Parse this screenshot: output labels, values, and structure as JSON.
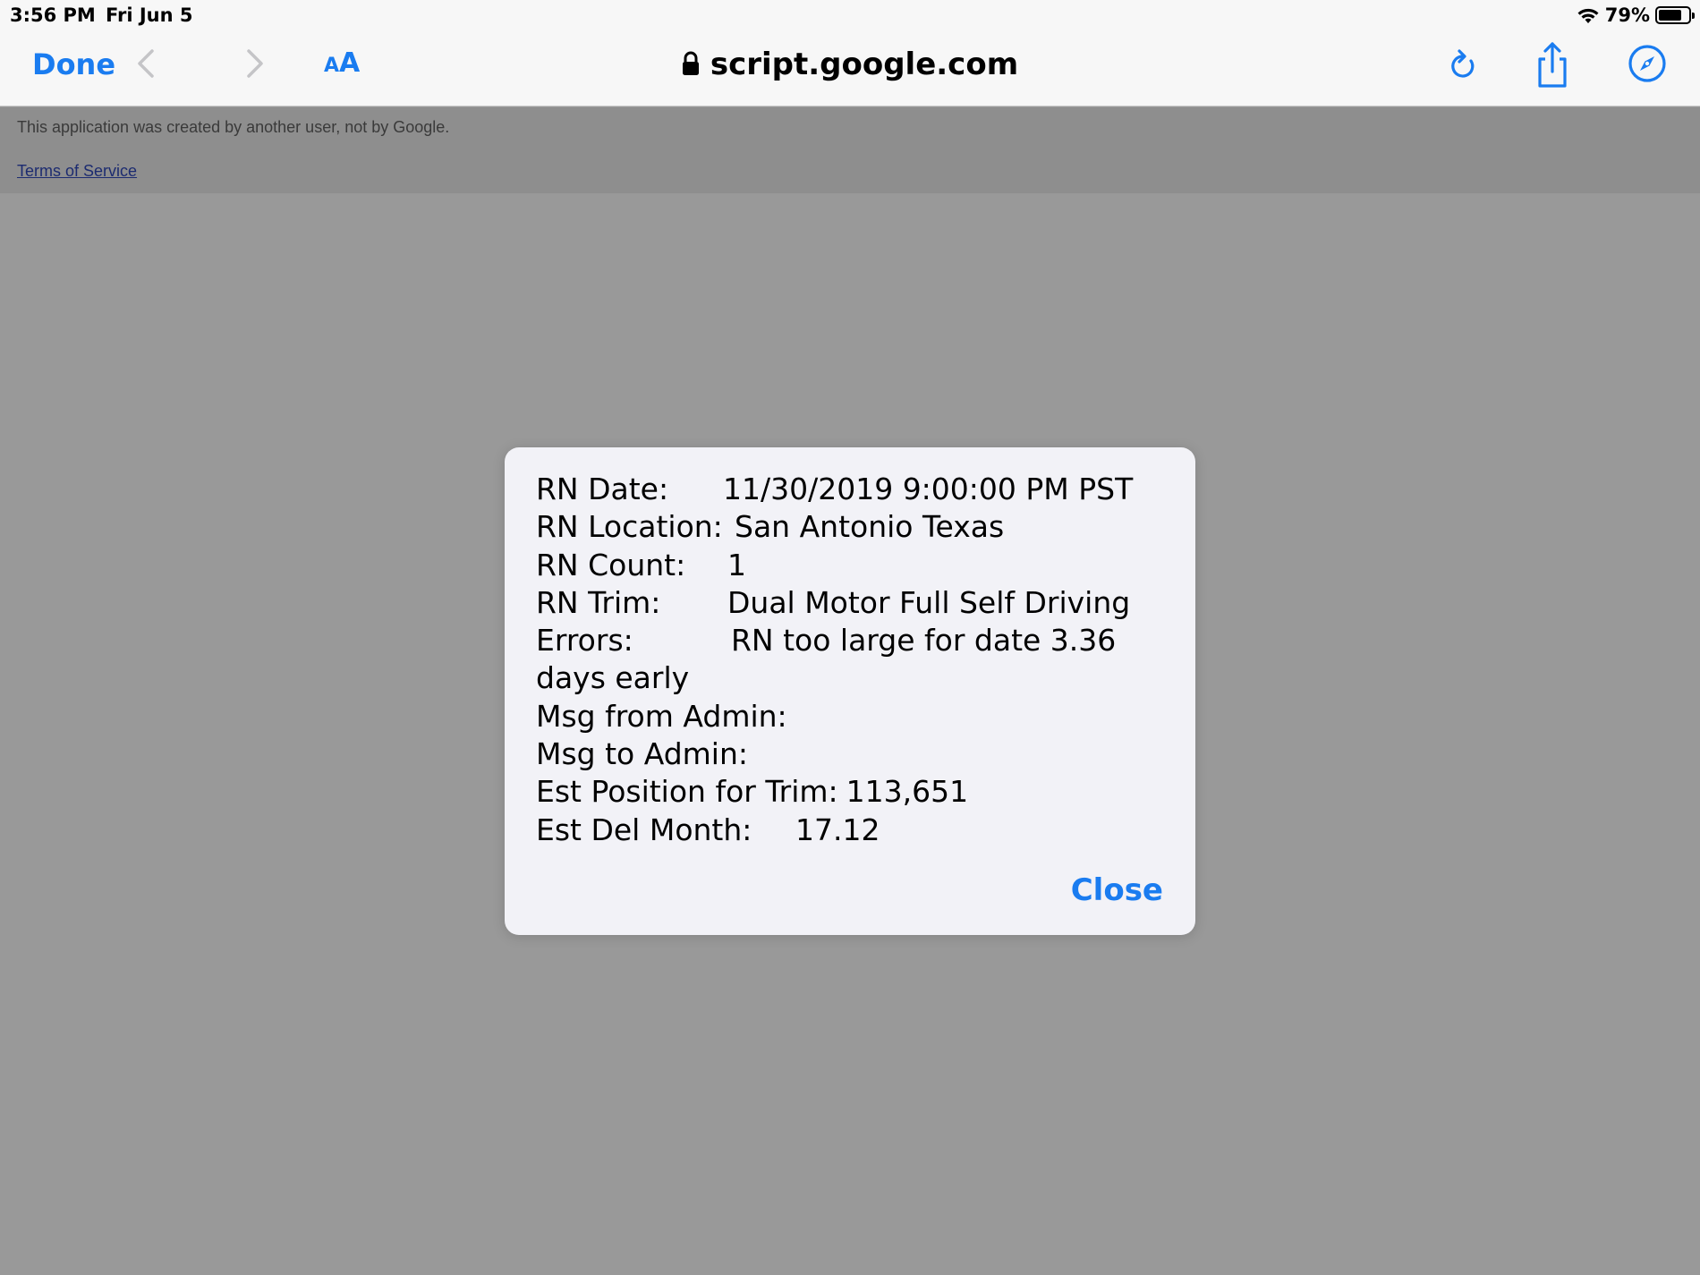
{
  "status_bar": {
    "time": "3:56 PM",
    "date": "Fri Jun 5",
    "battery_percent": "79%",
    "battery_level": 0.79
  },
  "toolbar": {
    "done_label": "Done",
    "text_size_small": "A",
    "text_size_large": "A",
    "url": "script.google.com",
    "icons": [
      "back-icon",
      "forward-icon",
      "lock-icon",
      "reload-icon",
      "share-icon",
      "compass-icon"
    ]
  },
  "page": {
    "notice": "This application was created by another user, not by Google.",
    "terms_link": "Terms of Service"
  },
  "dialog": {
    "rows": [
      {
        "label": "RN Date:",
        "value": "11/30/2019 9:00:00 PM PST"
      },
      {
        "label": "RN Location:",
        "value": "San Antonio Texas"
      },
      {
        "label": "RN Count:",
        "value": "1"
      },
      {
        "label": "RN Trim:",
        "value": "Dual Motor Full Self Driving"
      },
      {
        "label": "Errors:",
        "value": "RN too large for date 3.36 days early"
      },
      {
        "label": "Msg from Admin:",
        "value": ""
      },
      {
        "label": "Msg to Admin:",
        "value": ""
      },
      {
        "label": "Est Position for Trim:",
        "value": "113,651"
      },
      {
        "label": "Est Del Month:",
        "value": "17.12"
      }
    ],
    "close_label": "Close"
  },
  "colors": {
    "accent": "#1a7cf0",
    "backdrop": "#999999",
    "dialog_bg": "#f2f2f7"
  }
}
